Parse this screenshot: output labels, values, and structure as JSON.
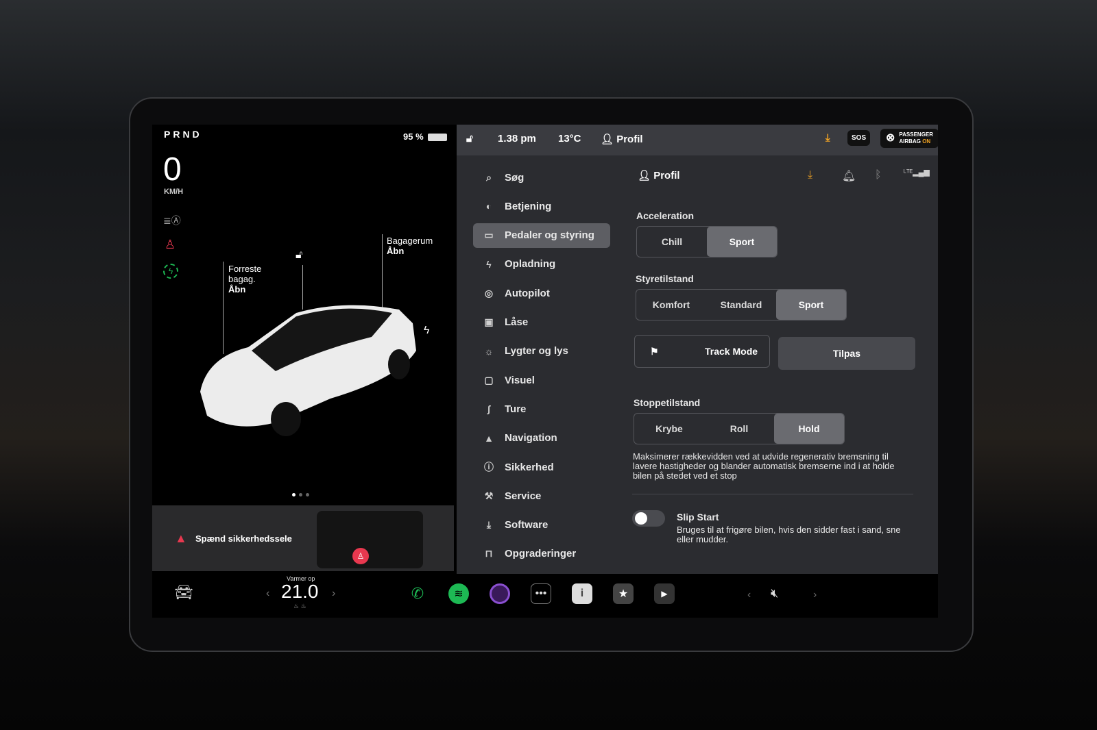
{
  "left_panel": {
    "gear": "PRND",
    "speed": "0",
    "speed_unit": "KM/H",
    "battery": "95 %",
    "frunk_label": "Forreste bagag.",
    "frunk_action": "Åbn",
    "trunk_label": "Bagagerum",
    "trunk_action": "Åbn",
    "alert": "Spænd sikkerhedssele"
  },
  "status_bar": {
    "time": "1.38 pm",
    "temperature": "13°C",
    "profile": "Profil",
    "sos": "SOS",
    "airbag_line1": "PASSENGER",
    "airbag_line2": "AIRBAG",
    "airbag_state": "ON"
  },
  "menu": [
    {
      "label": "Søg",
      "icon": "search-icon"
    },
    {
      "label": "Betjening",
      "icon": "toggle-icon"
    },
    {
      "label": "Pedaler og styring",
      "icon": "car-icon",
      "active": true
    },
    {
      "label": "Opladning",
      "icon": "bolt-icon"
    },
    {
      "label": "Autopilot",
      "icon": "steering-wheel-icon"
    },
    {
      "label": "Låse",
      "icon": "lock-icon"
    },
    {
      "label": "Lygter og lys",
      "icon": "sun-icon"
    },
    {
      "label": "Visuel",
      "icon": "display-icon"
    },
    {
      "label": "Ture",
      "icon": "trips-icon"
    },
    {
      "label": "Navigation",
      "icon": "navigation-icon"
    },
    {
      "label": "Sikkerhed",
      "icon": "safety-icon"
    },
    {
      "label": "Service",
      "icon": "wrench-icon"
    },
    {
      "label": "Software",
      "icon": "download-icon"
    },
    {
      "label": "Opgraderinger",
      "icon": "bag-icon"
    }
  ],
  "content": {
    "profile": "Profil",
    "acceleration": {
      "title": "Acceleration",
      "options": [
        "Chill",
        "Sport"
      ],
      "selected": "Sport"
    },
    "steering": {
      "title": "Styretilstand",
      "options": [
        "Komfort",
        "Standard",
        "Sport"
      ],
      "selected": "Sport"
    },
    "track_mode": "Track Mode",
    "customize": "Tilpas",
    "stopping": {
      "title": "Stoppetilstand",
      "options": [
        "Krybe",
        "Roll",
        "Hold"
      ],
      "selected": "Hold",
      "description": "Maksimerer rækkevidden ved at udvide regenerativ bremsning til lavere hastigheder og blander automatisk bremserne ind i at holde bilen på stedet ved et stop"
    },
    "slip_start": {
      "title": "Slip Start",
      "description": "Bruges til at frigøre bilen, hvis den sidder fast i sand, sne eller mudder.",
      "enabled": false
    }
  },
  "bottom_bar": {
    "climate_label": "Varmer op",
    "temperature": "21.0",
    "apps": [
      "phone-icon",
      "spotify-icon",
      "camera-icon",
      "more-icon",
      "manual-icon",
      "toybox-icon",
      "theater-icon"
    ],
    "volume": "muted"
  },
  "colors": {
    "accent_orange": "#f5a623",
    "alert_red": "#e8384f",
    "green": "#1db954"
  }
}
